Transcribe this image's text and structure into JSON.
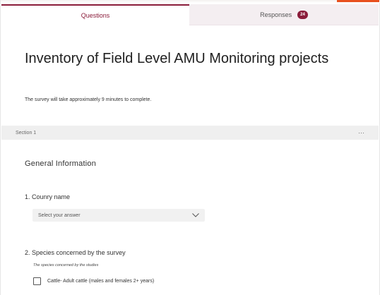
{
  "tabs": {
    "questions": "Questions",
    "responses": "Responses",
    "responses_count": "24"
  },
  "form": {
    "title": "Inventory of Field Level AMU Monitoring projects",
    "description": "The survey will take approximately 9 minutes to complete."
  },
  "section": {
    "label": "Section 1",
    "more": "···",
    "heading": "General Information"
  },
  "questions": [
    {
      "title": "1. Counry name",
      "placeholder": "Select your answer"
    },
    {
      "title": "2. Species concerned by the survey",
      "subtitle": "The species concerned by the studies",
      "options": [
        "Cattle- Adult cattle (males and females 2+ years)"
      ]
    }
  ],
  "colors": {
    "accent": "#8a1c3a",
    "corner_accent": "#e8501e"
  }
}
